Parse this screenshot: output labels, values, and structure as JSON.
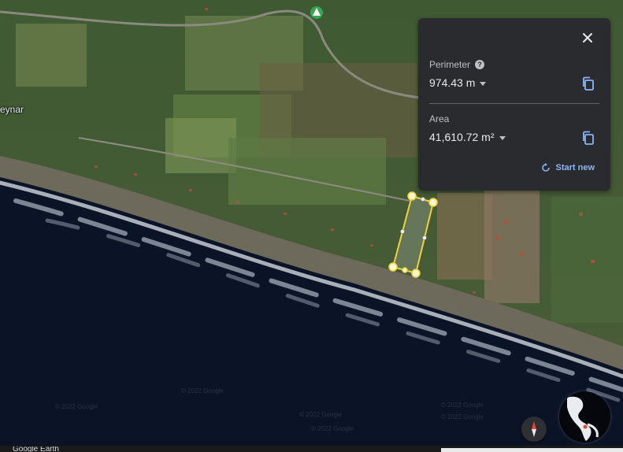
{
  "map": {
    "place_label": "eynar",
    "watermarks": [
      "© 2022 Google",
      "© 2022 Google",
      "© 2022 Google",
      "© 2022 Google",
      "© 2022 Google",
      "© 2022 Google"
    ],
    "colors": {
      "ocean": "#0b1427",
      "surf": "#d8dee6",
      "beach": "#6d6a5f",
      "vegetation": "#3d5a2c",
      "field": "#6b7d4a",
      "polygon": "#f2d13a",
      "pin": "#34a853"
    }
  },
  "measure": {
    "perimeter_label": "Perimeter",
    "perimeter_value": "974.43 m",
    "area_label": "Area",
    "area_value": "41,610.72 m²",
    "start_new_label": "Start new",
    "icons": {
      "close": "close-icon",
      "help": "help-icon",
      "copy": "copy-icon",
      "start_new": "refresh-icon"
    }
  },
  "footer": {
    "brand_text": "Google Earth"
  }
}
